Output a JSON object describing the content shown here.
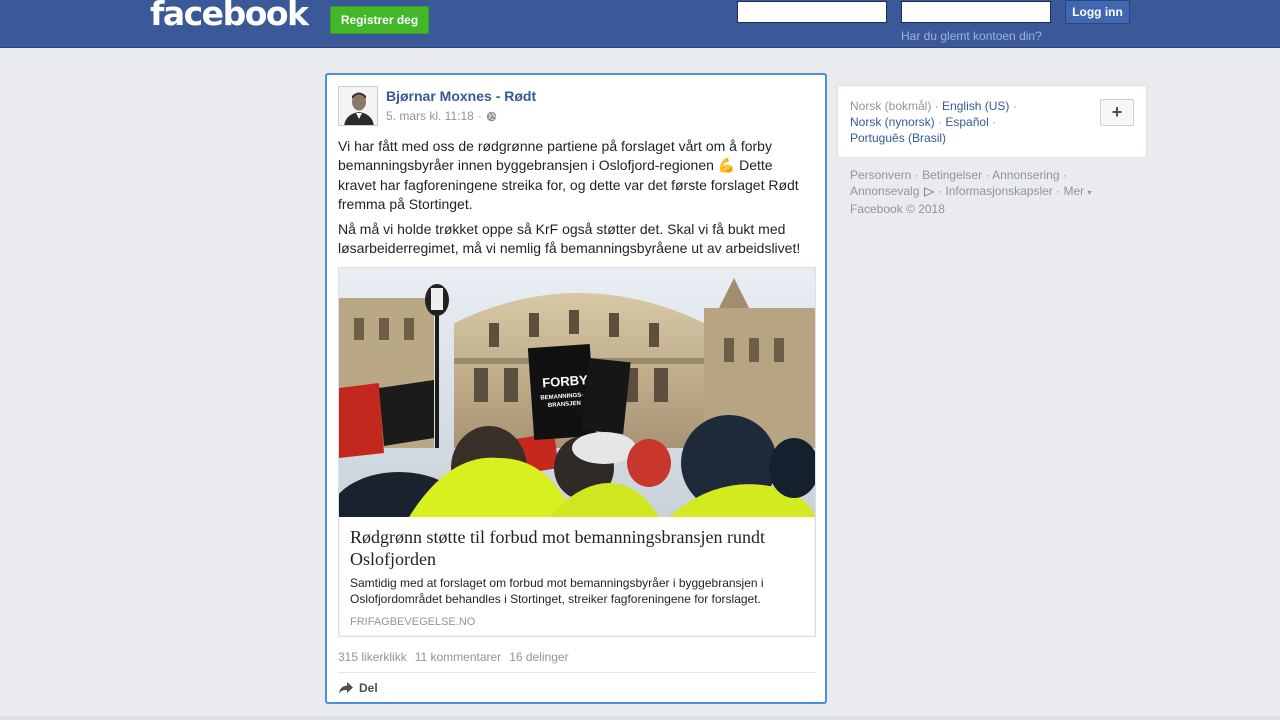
{
  "header": {
    "logo": "facebook",
    "register_label": "Registrer deg",
    "email_value": "",
    "password_value": "",
    "login_label": "Logg inn",
    "forgot_label": "Har du glemt kontoen din?"
  },
  "post": {
    "author": "Bjørnar Moxnes - Rødt",
    "date": "5. mars kl. 11:18",
    "date_separator": "·",
    "privacy_icon": "globe-icon",
    "paragraph_1_before_emoji": "Vi har fått med oss de rødgrønne partiene på forslaget vårt om å forby bemanningsbyråer innen byggebransjen i Oslofjord-regionen",
    "emoji": "💪",
    "paragraph_1_after_emoji": "Dette kravet har fagforeningene streika for, og dette var det første forslaget Rødt fremma på Stortinget.",
    "paragraph_2": "Nå må vi holde trøkket oppe så KrF også støtter det. Skal vi få bukt med løsarbeiderregimet, må vi nemlig få bemanningsbyråene ut av arbeidslivet!",
    "link": {
      "image_sign_line1": "FORBY",
      "image_sign_line2": "BEMANNINGS-",
      "image_sign_line3": "BRANSJEN",
      "title": "Rødgrønn støtte til forbud mot bemanningsbransjen rundt Oslofjorden",
      "description": "Samtidig med at forslaget om forbud mot bemanningsbyråer i byggebransjen i Oslofjordområdet behandles i Stortinget, streiker fagforeningene for forslaget.",
      "domain": "FRIFAGBEVEGELSE.NO"
    },
    "stats": {
      "likes": "315 likerklikk",
      "comments": "11 kommentarer",
      "shares": "16 delinger"
    },
    "share_label": "Del"
  },
  "sidebar": {
    "languages": {
      "current": "Norsk (bokmål)",
      "english": "English (US)",
      "nynorsk": "Norsk (nynorsk)",
      "spanish": "Español",
      "portuguese": "Português (Brasil)",
      "separator": "·",
      "add_label": "+"
    },
    "footer": {
      "privacy": "Personvern",
      "terms": "Betingelser",
      "advertising": "Annonsering",
      "adchoices": "Annonsevalg",
      "cookies": "Informasjonskapsler",
      "more": "Mer",
      "copyright": "Facebook © 2018"
    }
  },
  "colors": {
    "brand_blue": "#3b5998",
    "register_green": "#42b72a",
    "link_blue": "#365899",
    "focus_border": "#4b8fe2"
  }
}
